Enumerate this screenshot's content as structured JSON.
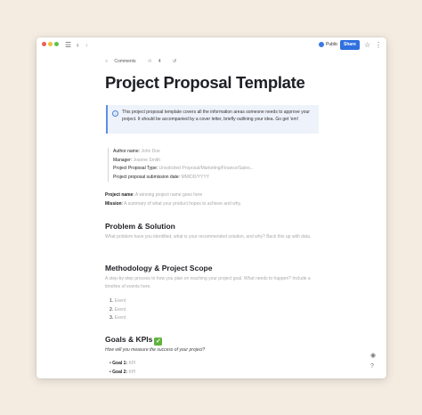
{
  "toolbar": {
    "public_label": "Public",
    "share_label": "Share"
  },
  "meta": {
    "comments_label": "Comments",
    "views_count": "4"
  },
  "doc": {
    "title": "Project Proposal Template",
    "callout": "This project proposal template covers all the information areas someone needs to approve your project. It should be accompanied by a cover letter, briefly outlining your idea. Go get 'em!",
    "author_fields": [
      {
        "label": "Author name",
        "value": "John Doe"
      },
      {
        "label": "Manager",
        "value": "Joanne Smith"
      },
      {
        "label": "Project Proposal Type",
        "value": "Unsolicited Proposal/Marketing/Finance/Sales..."
      },
      {
        "label": "Project proposal submission date",
        "value": "MM/DD/YYYY"
      }
    ],
    "project_name_label": "Project name",
    "project_name_value": "A winning project name goes here",
    "mission_label": "Mission",
    "mission_value": "A summary of what your product hopes to achieve and why.",
    "problem_heading": "Problem & Solution",
    "problem_text": "What problem have you identified, what is your recommended solution, and why? Back this up with data.",
    "methodology_heading": "Methodology & Project Scope",
    "methodology_text": "A step-by-step process to how you plan on reaching your project goal. What needs to happen? Include a timeline of events here.",
    "events": [
      "Event",
      "Event",
      "Event"
    ],
    "goals_heading": "Goals & KPIs",
    "goals_intro": "How will you measure the success of your project?",
    "goals": [
      {
        "label": "Goal 1:",
        "value": "KPI"
      },
      {
        "label": "Goal 2:",
        "value": "KPI"
      }
    ]
  },
  "colors": {
    "accent": "#2f6fe0",
    "callout_bg": "#eef2fb",
    "check": "#5fb43c"
  }
}
